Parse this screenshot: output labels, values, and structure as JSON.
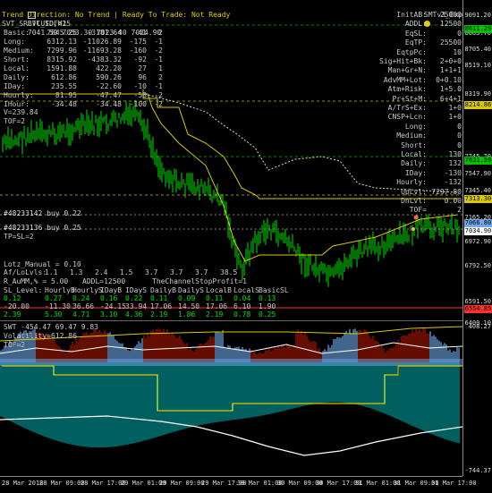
{
  "header": {
    "symbol": "BTCUSD,M15",
    "ohlc": "7041.50 7053.30 7023.40 7034.90",
    "indicator_name": "SMTv3_Exp",
    "status": {
      "label1": "Trend Direction:",
      "val1": "No Trend",
      "sep": "|",
      "label2": "Ready To Trade:",
      "val2": "Not Ready"
    },
    "sub_title": "SVT_SRLvl_TOF=2"
  },
  "colors": {
    "up": "#00e000",
    "line": "#d8c800",
    "frame": "#ffffff",
    "dotted": "#e0e0a0",
    "red_block": "#a81800",
    "blue_fill": "#6fa8e8",
    "teal": "#00a0a0",
    "yellow_label": "#e0d000"
  },
  "left_table": {
    "rows": [
      [
        "Basic:",
        "7845.25",
        "-3181.64",
        "-41",
        "2"
      ],
      [
        "Long:",
        "6312.13",
        "-11026.89",
        "-175",
        "-1"
      ],
      [
        "Medium:",
        "7299.96",
        "-11693.28",
        "-160",
        "-2"
      ],
      [
        "Short:",
        "8315.92",
        "-4383.32",
        "-92",
        "-1"
      ],
      [
        "Local:",
        "1591.88",
        "422.20",
        "27",
        "1"
      ],
      [
        "Daily:",
        "612.86",
        "590.26",
        "96",
        "2"
      ],
      [
        "IDay:",
        "235.55",
        "-22.60",
        "-10",
        "-1"
      ],
      [
        "Hourly:",
        "81.95",
        "-47.47",
        "-58",
        "-2"
      ],
      [
        "IHour:",
        "-34.48",
        "-34.48",
        "-100",
        "-2"
      ]
    ],
    "v_line": "V=239.84",
    "tof": "TOF=2"
  },
  "right_panel": [
    [
      "InitAB:",
      "25000"
    ],
    [
      "ADDL:",
      "12500"
    ],
    [
      "EqSL:",
      "0"
    ],
    [
      "EqTP:",
      "25500"
    ],
    [
      "EqtpPc:",
      "10"
    ],
    [
      "Sig+Hit+Bk:",
      "2+0+0"
    ],
    [
      "Man+Gr+N:",
      "1+1+1"
    ],
    [
      "AdvMM+Lot:",
      "0+0.10"
    ],
    [
      "Atm+Risk:",
      "1+5.0"
    ],
    [
      "Pr+St+M:",
      "6+4+1"
    ],
    [
      "A/TrS+Ex:",
      "1+0"
    ],
    [
      "CNSP+Lcn:",
      "1+0"
    ],
    [
      "Long:",
      "0"
    ],
    [
      "Medium:",
      "0"
    ],
    [
      "Short:",
      "0"
    ],
    [
      "Local:",
      "130"
    ],
    [
      "Daily:",
      "132"
    ],
    [
      "IDay:",
      "-130"
    ],
    [
      "Hourly:",
      "-132"
    ],
    [
      "UpLvl:",
      "7297.80"
    ],
    [
      "DnLvl:",
      "0.00"
    ],
    [
      "TOF=",
      "2"
    ]
  ],
  "orders": [
    {
      "label": "#48233142 buy 0.22"
    },
    {
      "label": "#48233136 buy 0.25"
    }
  ],
  "sub_table": {
    "tpsl": "TP=SL=2",
    "lots": "Lotz_Manual = 0.10",
    "afl_label": "Af/LoLvls:",
    "afl_vals": [
      "1.1",
      "1.3",
      "2.4",
      "1.5",
      "3.7",
      "3.7",
      "3.7",
      "38.5"
    ],
    "rau": "R_AuMM,% = 5.00",
    "addl": "ADDL=12500",
    "channel": "TheChannelStopProfit=1",
    "sl_header": [
      "SL_Level:",
      "HourlyB",
      "HourlyS",
      "IDayB",
      "IDayS",
      "DailyB",
      "DailyS",
      "LocalB",
      "LocalS",
      "BasicSL"
    ],
    "sl_row1": [
      "0.12",
      "0.27",
      "0.24",
      "0.16",
      "0.22",
      "0.11",
      "0.09",
      "0.11",
      "0.04",
      "0.13"
    ],
    "sl_row2": [
      "-20.00",
      "-11.30",
      "36.66",
      "-24.15",
      "33.94",
      "17.06",
      "14.50",
      "17.06",
      "6.10",
      "1.90"
    ],
    "sl_row3": [
      "2.39",
      "5.30",
      "4.71",
      "3.10",
      "4.36",
      "2.19",
      "1.86",
      "2.19",
      "0.78",
      "0.25"
    ]
  },
  "price_scale": {
    "labels": [
      "9091.20",
      "8883.70",
      "8705.40",
      "8519.10",
      "8319.90",
      "7745.70",
      "7547.90",
      "7345.40",
      "7165.20",
      "6972.90",
      "6792.50",
      "6591.50",
      "6400.10"
    ],
    "tags": [
      {
        "text": "8611.29",
        "color": "#00c000"
      },
      {
        "text": "8214.86",
        "color": "#d8c800"
      },
      {
        "text": "7631.59",
        "color": "#00c000"
      },
      {
        "text": "7313.30",
        "color": "#d8c800"
      },
      {
        "text": "7066.80",
        "color": "#6fa8e8"
      },
      {
        "text": "7034.90",
        "color": "#ffffff"
      },
      {
        "text": "6554.85",
        "color": "#ff3030"
      }
    ]
  },
  "indicator": {
    "title": "SWT -454.47 69.47 9.83",
    "volatility": "Volatility=612.86",
    "tof": "TOF=2",
    "scale_top": "408.27",
    "scale_bottom": "-744.37"
  },
  "time_axis": [
    "28 Mar 2018",
    "28 Mar 09:00",
    "28 Mar 17:00",
    "29 Mar 01:00",
    "29 Mar 09:00",
    "29 Mar 17:00",
    "30 Mar 01:00",
    "30 Mar 09:00",
    "30 Mar 17:00",
    "31 Mar 01:00",
    "31 Mar 09:00",
    "31 Mar 17:00"
  ],
  "icons": {
    "window": "chart-icon",
    "smiley": "smiley-icon"
  }
}
